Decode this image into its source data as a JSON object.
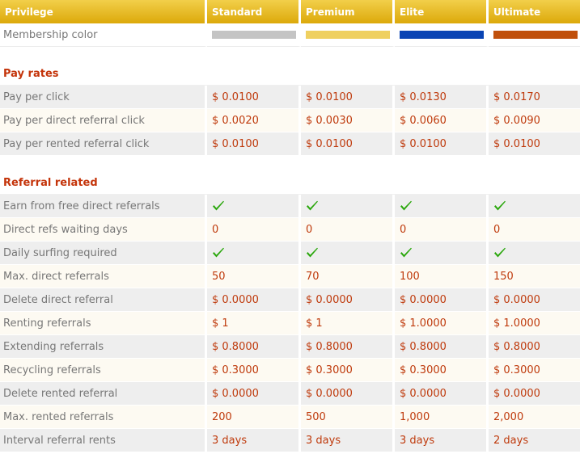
{
  "header": {
    "privilege": "Privilege",
    "standard": "Standard",
    "premium": "Premium",
    "elite": "Elite",
    "ultimate": "Ultimate"
  },
  "membership": {
    "label": "Membership color",
    "colors": [
      "#c4c4c4",
      "#efd060",
      "#0a44b4",
      "#c0500c"
    ]
  },
  "pay_rates": {
    "title": "Pay rates",
    "rows": [
      {
        "label": "Pay per click",
        "values": [
          "$ 0.0100",
          "$ 0.0100",
          "$ 0.0130",
          "$ 0.0170"
        ]
      },
      {
        "label": "Pay per direct referral click",
        "values": [
          "$ 0.0020",
          "$ 0.0030",
          "$ 0.0060",
          "$ 0.0090"
        ]
      },
      {
        "label": "Pay per rented referral click",
        "values": [
          "$ 0.0100",
          "$ 0.0100",
          "$ 0.0100",
          "$ 0.0100"
        ]
      }
    ]
  },
  "referral_related": {
    "title": "Referral related",
    "rows": [
      {
        "label": "Earn from free direct referrals",
        "values": [
          "check",
          "check",
          "check",
          "check"
        ]
      },
      {
        "label": "Direct refs waiting days",
        "values": [
          "0",
          "0",
          "0",
          "0"
        ]
      },
      {
        "label": "Daily surfing required",
        "values": [
          "check",
          "check",
          "check",
          "check"
        ]
      },
      {
        "label": "Max. direct referrals",
        "values": [
          "50",
          "70",
          "100",
          "150"
        ]
      },
      {
        "label": "Delete direct referral",
        "values": [
          "$ 0.0000",
          "$ 0.0000",
          "$ 0.0000",
          "$ 0.0000"
        ]
      },
      {
        "label": "Renting referrals",
        "values": [
          "$ 1",
          "$ 1",
          "$ 1.0000",
          "$ 1.0000"
        ]
      },
      {
        "label": "Extending referrals",
        "values": [
          "$ 0.8000",
          "$ 0.8000",
          "$ 0.8000",
          "$ 0.8000"
        ]
      },
      {
        "label": "Recycling referrals",
        "values": [
          "$ 0.3000",
          "$ 0.3000",
          "$ 0.3000",
          "$ 0.3000"
        ]
      },
      {
        "label": "Delete rented referral",
        "values": [
          "$ 0.0000",
          "$ 0.0000",
          "$ 0.0000",
          "$ 0.0000"
        ]
      },
      {
        "label": "Max. rented referrals",
        "values": [
          "200",
          "500",
          "1,000",
          "2,000"
        ]
      },
      {
        "label": "Interval referral rents",
        "values": [
          "3 days",
          "3 days",
          "3 days",
          "2 days"
        ]
      }
    ]
  },
  "check_color": "#2aa70c"
}
